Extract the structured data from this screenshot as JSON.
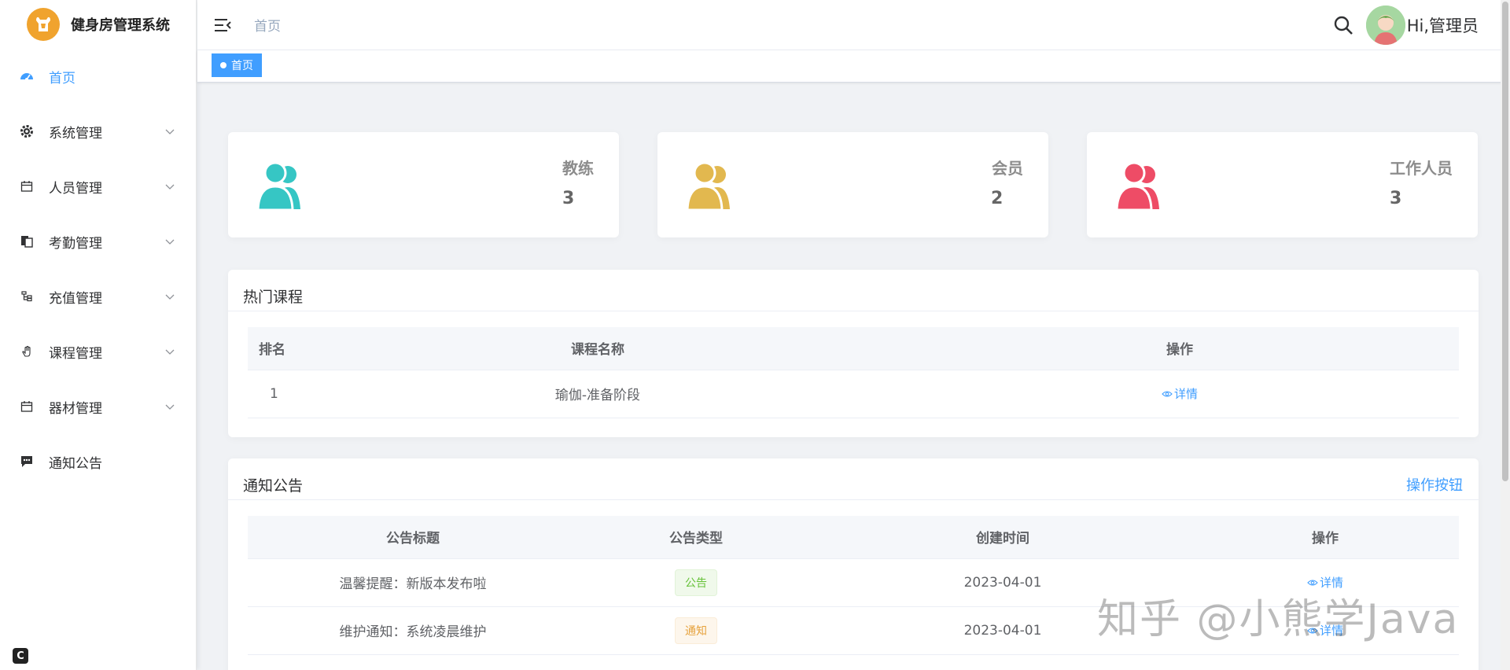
{
  "app": {
    "title": "健身房管理系统"
  },
  "sidebar": {
    "items": [
      {
        "label": "首页",
        "icon": "dashboard-icon",
        "active": true,
        "has_children": false
      },
      {
        "label": "系统管理",
        "icon": "gear-icon",
        "active": false,
        "has_children": true
      },
      {
        "label": "人员管理",
        "icon": "calendar-icon",
        "active": false,
        "has_children": true
      },
      {
        "label": "考勤管理",
        "icon": "clipboard-icon",
        "active": false,
        "has_children": true
      },
      {
        "label": "充值管理",
        "icon": "tree-icon",
        "active": false,
        "has_children": true
      },
      {
        "label": "课程管理",
        "icon": "hand-icon",
        "active": false,
        "has_children": true
      },
      {
        "label": "器材管理",
        "icon": "calendar-icon",
        "active": false,
        "has_children": true
      },
      {
        "label": "通知公告",
        "icon": "message-icon",
        "active": false,
        "has_children": false
      }
    ],
    "corner_badge": "C"
  },
  "header": {
    "breadcrumb": "首页",
    "greeting": "Hi,管理员"
  },
  "tags": {
    "active_tag": "首页"
  },
  "stats": [
    {
      "label": "教练",
      "value": "3",
      "color": "#36c6c4"
    },
    {
      "label": "会员",
      "value": "2",
      "color": "#e2b84f"
    },
    {
      "label": "工作人员",
      "value": "3",
      "color": "#ee4c66"
    }
  ],
  "popular_courses": {
    "title": "热门课程",
    "columns": [
      "排名",
      "课程名称",
      "操作"
    ],
    "rows": [
      {
        "rank": "1",
        "name": "瑜伽-准备阶段",
        "action": "详情"
      }
    ]
  },
  "notices": {
    "title": "通知公告",
    "action_label": "操作按钮",
    "columns": [
      "公告标题",
      "公告类型",
      "创建时间",
      "操作"
    ],
    "rows": [
      {
        "title": "温馨提醒：新版本发布啦",
        "type": "公告",
        "type_color": "green",
        "created": "2023-04-01",
        "action": "详情"
      },
      {
        "title": "维护通知：系统凌晨维护",
        "type": "通知",
        "type_color": "orange",
        "created": "2023-04-01",
        "action": "详情"
      }
    ]
  },
  "watermark": "知乎 @小熊学Java",
  "accent": "#409eff"
}
